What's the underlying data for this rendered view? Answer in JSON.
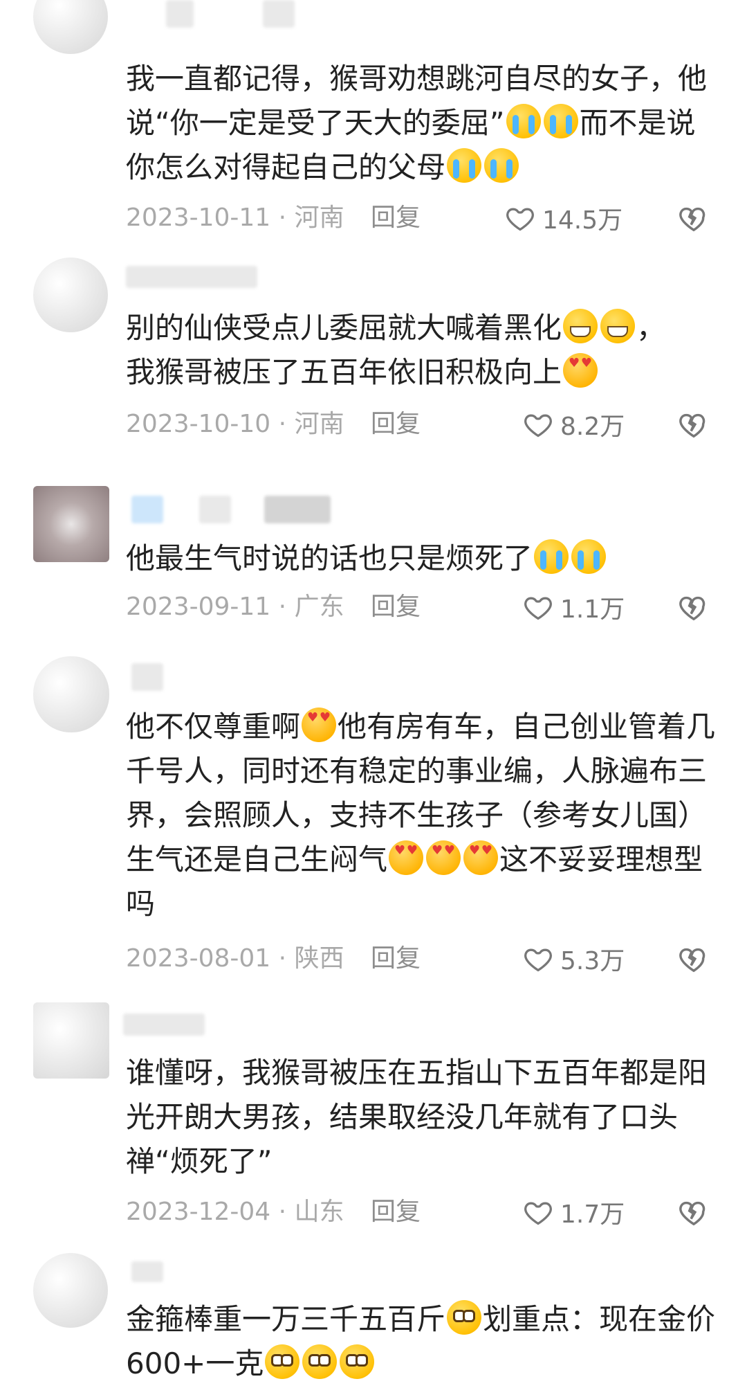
{
  "comments": [
    {
      "text": "我一直都记得，猴哥劝想跳河自尽的女子，他说“你一定是受了天大的委屈”",
      "text_end": "而不是说你怎么对得起自己的父母",
      "date": "2023-10-11",
      "location": "河南",
      "reply": "回复",
      "likes": "14.5万"
    },
    {
      "text": "别的仙侠受点儿委屈就大喊着黑化",
      "text_after": "，",
      "text_line2": "我猴哥被压了五百年依旧积极向上",
      "date": "2023-10-10",
      "location": "河南",
      "reply": "回复",
      "likes": "8.2万"
    },
    {
      "text": "他最生气时说的话也只是烦死了",
      "date": "2023-09-11",
      "location": "广东",
      "reply": "回复",
      "likes": "1.1万"
    },
    {
      "text_a": "他不仅尊重啊",
      "text_b": "他有房有车，自己创业管着几千号人，同时还有稳定的事业编，人脉遍布三界，会照顾人，支持不生孩子（参考女儿国）生气还是自己生闷气",
      "text_c": "这不妥妥理想型吗",
      "date": "2023-08-01",
      "location": "陕西",
      "reply": "回复",
      "likes": "5.3万"
    },
    {
      "text": "谁懂呀，我猴哥被压在五指山下五百年都是阳光开朗大男孩，结果取经没几年就有了口头禅“烦死了”",
      "date": "2023-12-04",
      "location": "山东",
      "reply": "回复",
      "likes": "1.7万"
    },
    {
      "text_a": "金箍棒重一万三千五百斤",
      "text_b": "划重点：现在金价600+一克"
    }
  ],
  "meta_separator": " · ",
  "icons": {
    "like": "heart-outline-icon",
    "dislike": "broken-heart-icon"
  },
  "colors": {
    "text": "#222222",
    "meta": "#a9a9a9",
    "icon": "#777777"
  }
}
